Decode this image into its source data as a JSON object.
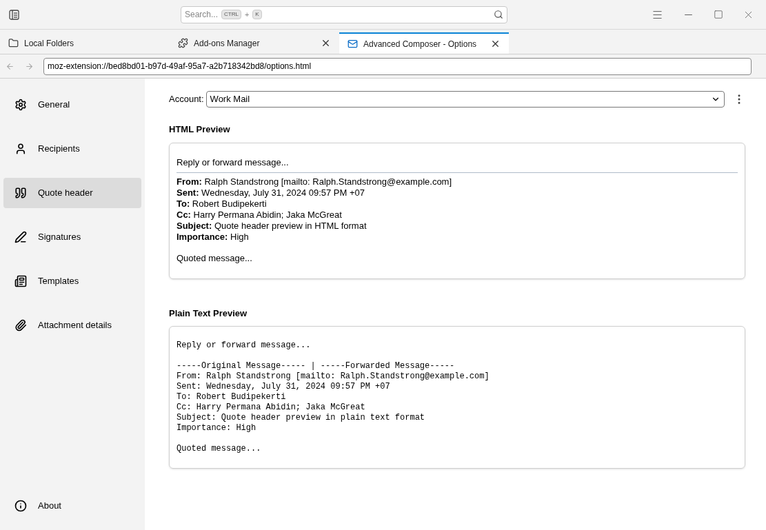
{
  "search": {
    "placeholder": "Search...",
    "keys": [
      "CTRL",
      "+",
      "K"
    ]
  },
  "tabs": [
    {
      "label": "Local Folders",
      "selected": false,
      "closable": false
    },
    {
      "label": "Add-ons Manager",
      "selected": false,
      "closable": true
    },
    {
      "label": "Advanced Composer - Options",
      "selected": true,
      "closable": true
    }
  ],
  "address": "moz-extension://bed8bd01-b97d-49af-95a7-a2b718342bd8/options.html",
  "sidebar": {
    "items": [
      {
        "label": "General",
        "selected": false
      },
      {
        "label": "Recipients",
        "selected": false
      },
      {
        "label": "Quote header",
        "selected": true
      },
      {
        "label": "Signatures",
        "selected": false
      },
      {
        "label": "Templates",
        "selected": false
      },
      {
        "label": "Attachment details",
        "selected": false
      }
    ],
    "footer": {
      "label": "About",
      "selected": false
    }
  },
  "account": {
    "label": "Account:",
    "value": "Work Mail"
  },
  "html_preview": {
    "title": "HTML Preview",
    "intro": "Reply or forward message...",
    "headers": [
      "**From:** Ralph Standstrong [mailto: Ralph.Standstrong@example.com]",
      "**Sent:** Wednesday, July 31, 2024 09:57 PM +07",
      "**To:** Robert Budipekerti",
      "**Cc:** Harry Permana Abidin; Jaka McGreat",
      "**Subject:** Quote header preview in HTML format",
      "**Importance:** High"
    ],
    "outro": "Quoted message..."
  },
  "plain_preview": {
    "title": "Plain Text Preview",
    "intro": "Reply or forward message...",
    "separator": "-----Original Message----- | -----Forwarded Message-----",
    "headers": [
      "From: Ralph Standstrong [mailto: Ralph.Standstrong@example.com]",
      "Sent: Wednesday, July 31, 2024 09:57 PM +07",
      "To: Robert Budipekerti",
      "Cc: Harry Permana Abidin; Jaka McGreat",
      "Subject: Quote header preview in plain text format",
      "Importance: High"
    ],
    "outro": "Quoted message..."
  }
}
